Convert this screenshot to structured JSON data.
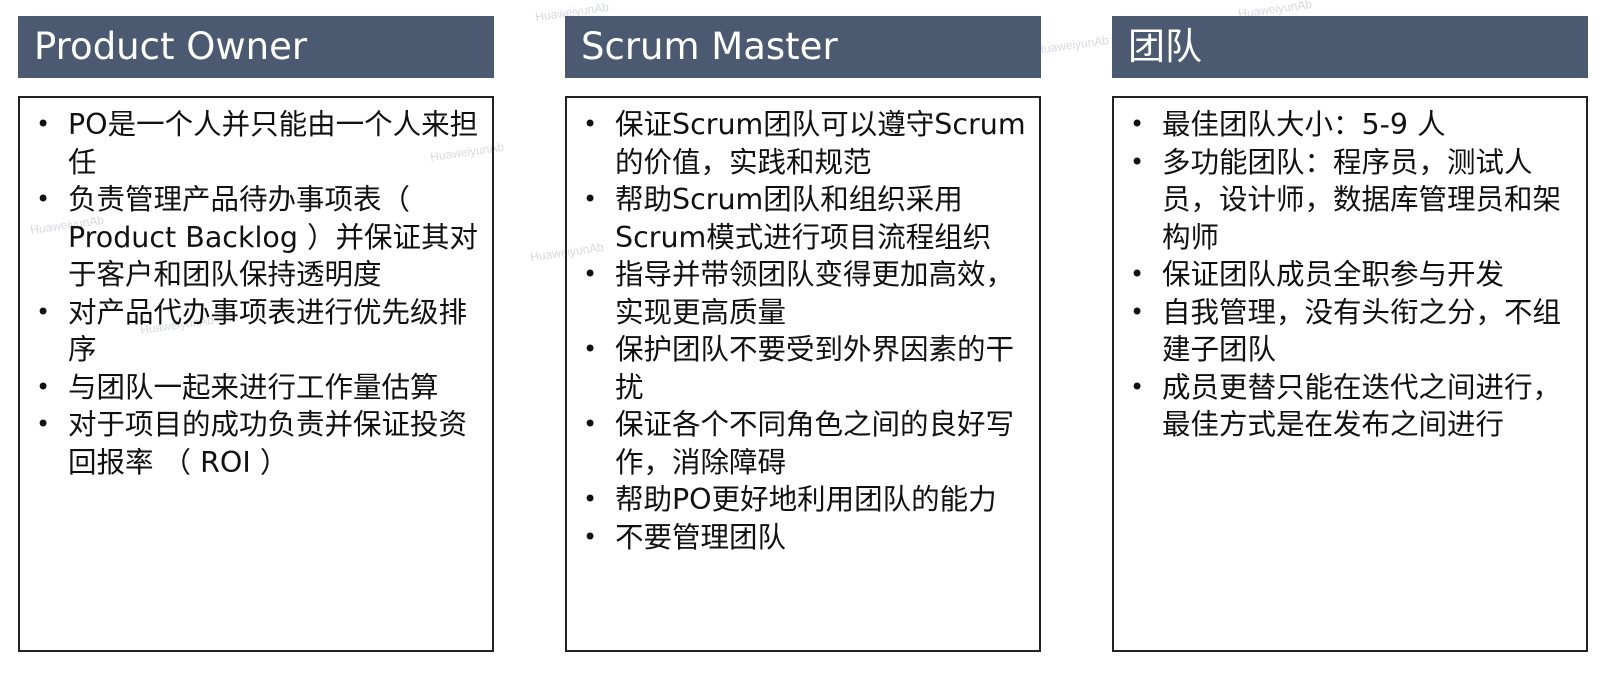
{
  "watermark": "HuaweiyunAb",
  "columns": [
    {
      "title": "Product Owner",
      "items": [
        "PO是一个人并只能由一个人来担任",
        "负责管理产品待办事项表（ Product Backlog ）并保证其对于客户和团队保持透明度",
        "对产品代办事项表进行优先级排序",
        "与团队一起来进行工作量估算",
        "对于项目的成功负责并保证投资回报率 （ ROI ）"
      ]
    },
    {
      "title": "Scrum Master",
      "items": [
        "保证Scrum团队可以遵守Scrum的价值，实践和规范",
        "帮助Scrum团队和组织采用Scrum模式进行项目流程组织",
        "指导并带领团队变得更加高效，实现更高质量",
        "保护团队不要受到外界因素的干扰",
        "保证各个不同角色之间的良好写作，消除障碍",
        "帮助PO更好地利用团队的能力",
        "不要管理团队"
      ]
    },
    {
      "title": "团队",
      "items": [
        "最佳团队大小：5-9 人",
        "多功能团队：程序员，测试人员，设计师，数据库管理员和架构师",
        "保证团队成员全职参与开发",
        "自我管理，没有头衔之分，不组建子团队",
        "成员更替只能在迭代之间进行，最佳方式是在发布之间进行"
      ]
    }
  ]
}
